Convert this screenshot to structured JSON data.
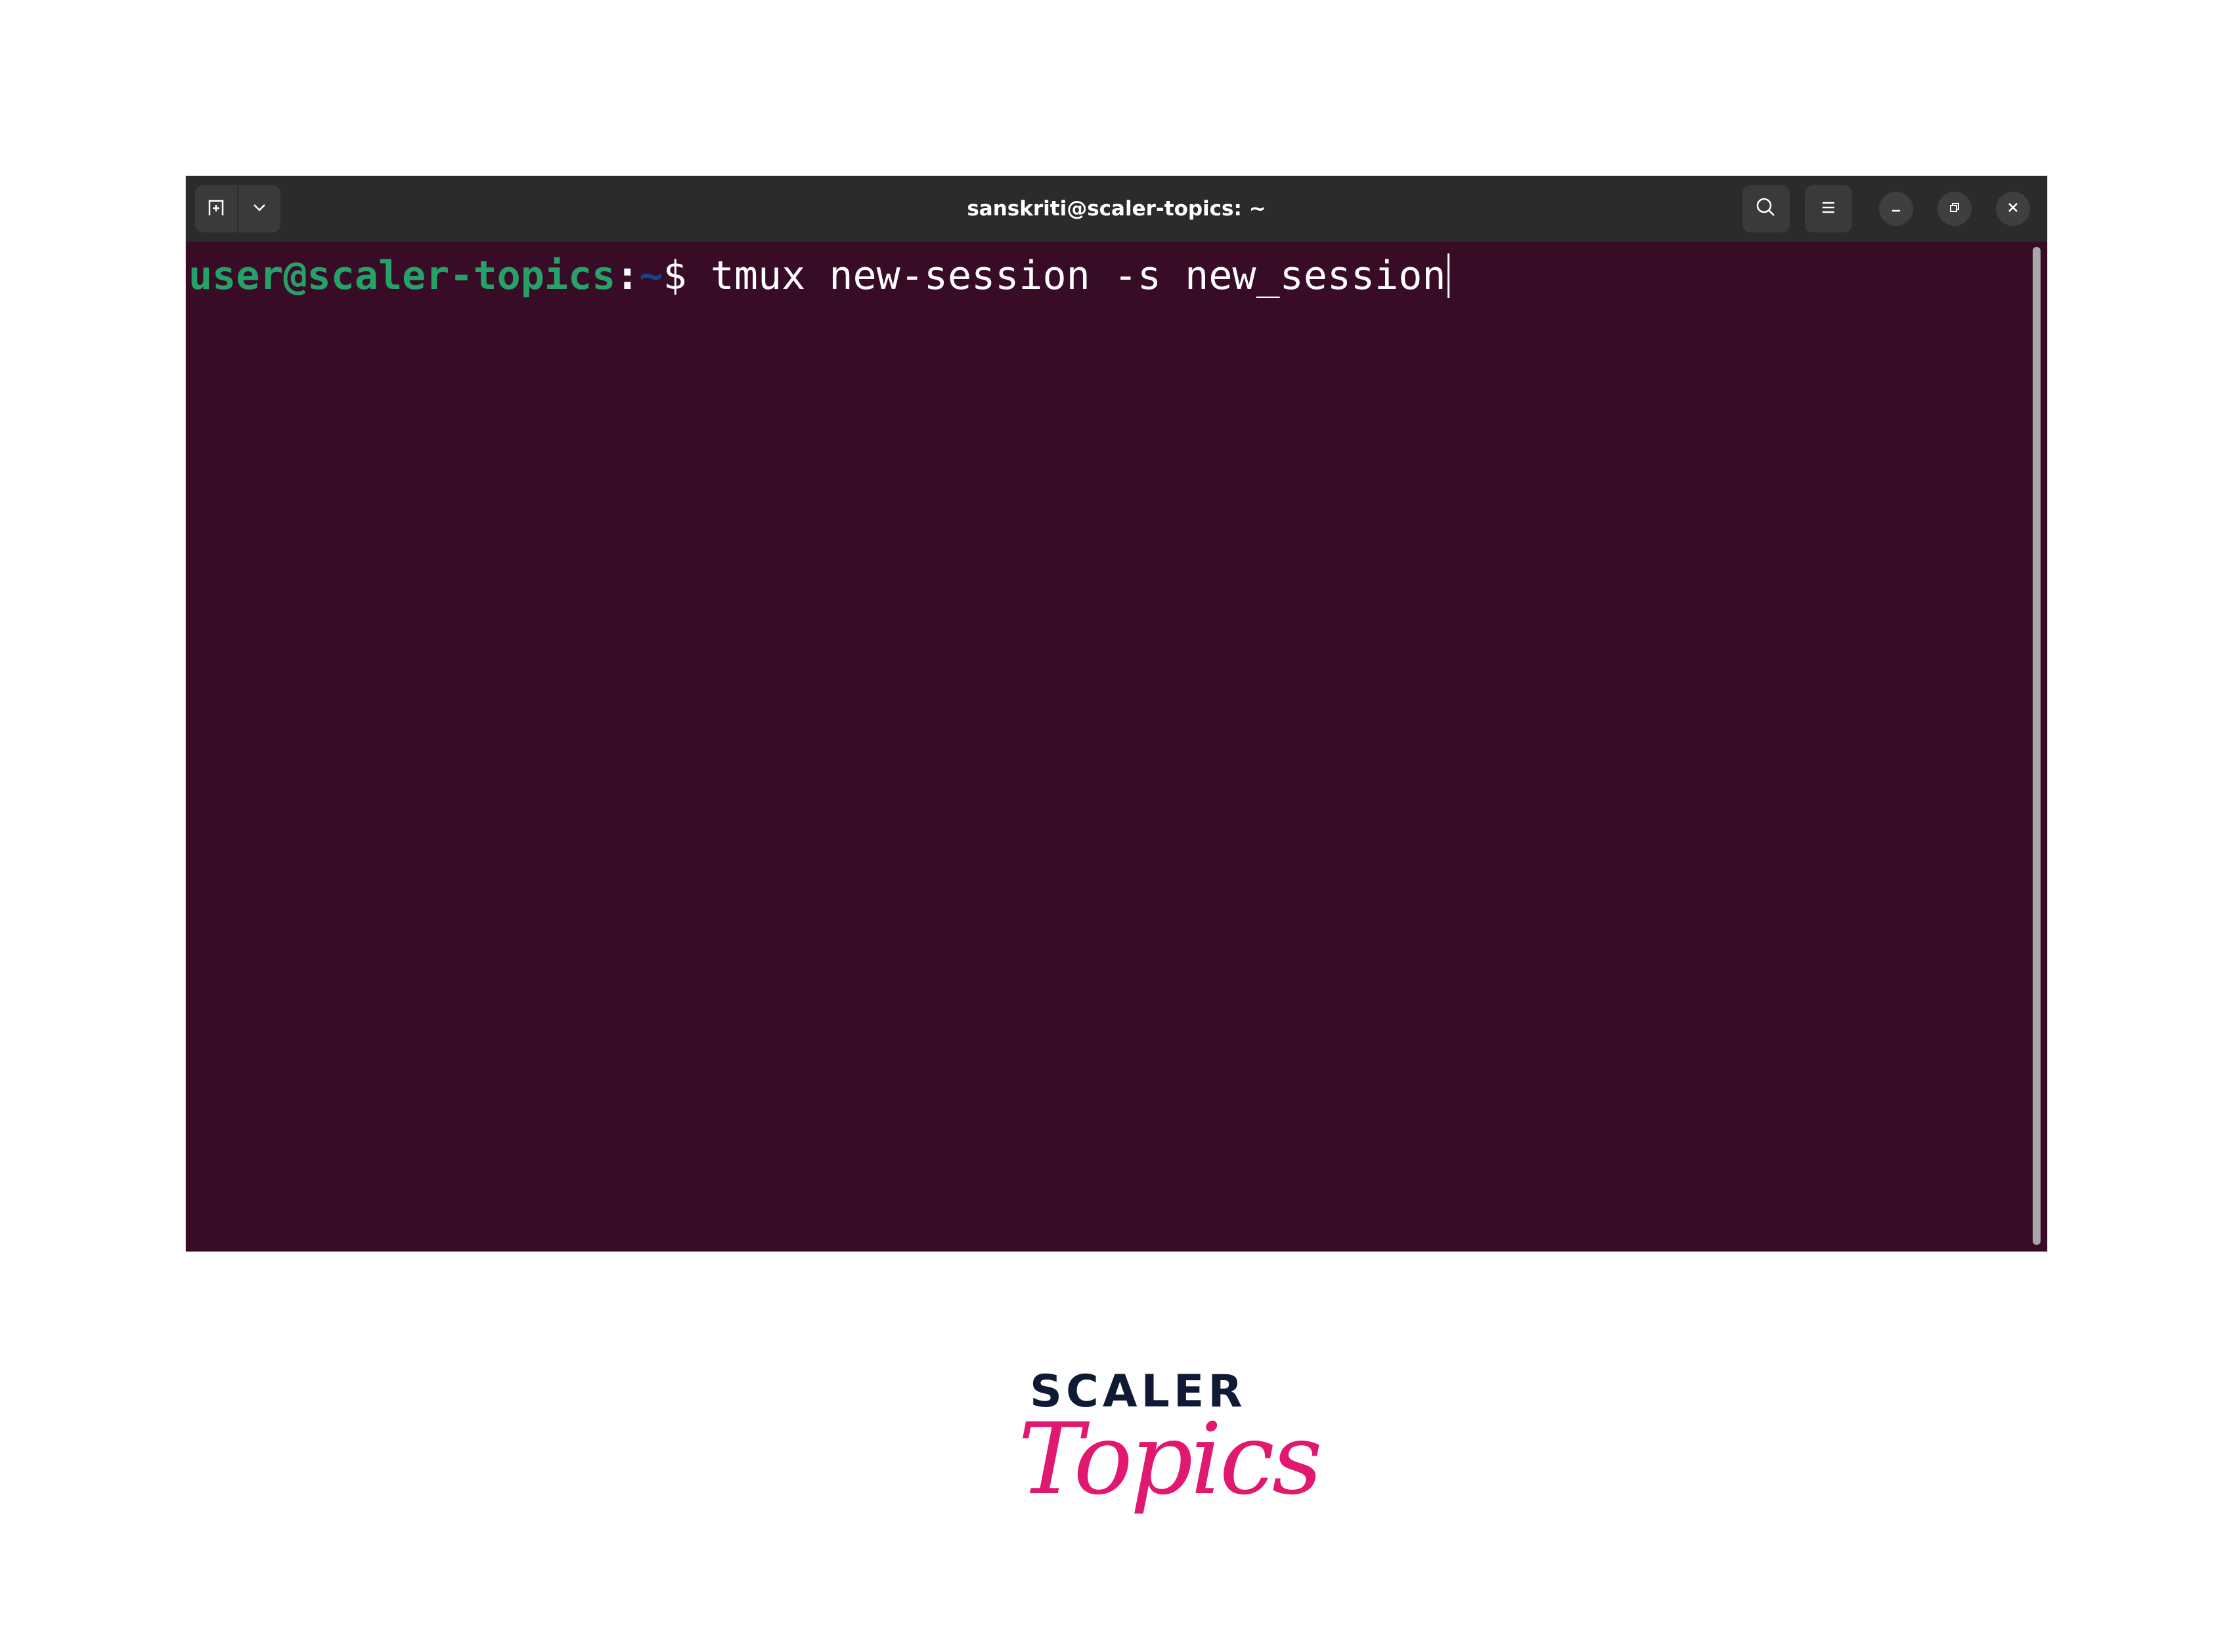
{
  "window": {
    "title": "sanskriti@scaler-topics: ~"
  },
  "toolbar": {
    "new_tab_icon": "new-tab-icon",
    "tab_dropdown_icon": "chevron-down-icon",
    "search_icon": "search-icon",
    "menu_icon": "hamburger-menu-icon",
    "minimize_icon": "minimize-icon",
    "maximize_icon": "restore-icon",
    "close_icon": "close-icon"
  },
  "terminal": {
    "prompt_user_host": "user@scaler-topics",
    "prompt_colon": ":",
    "prompt_path": "~",
    "prompt_symbol": "$",
    "command": " tmux new-session -s new_session"
  },
  "colors": {
    "terminal_bg": "#380c26",
    "titlebar_bg": "#2b2b2b",
    "prompt_user": "#26a269",
    "prompt_path": "#12488b",
    "logo_dark": "#0f1a35",
    "logo_pink": "#e0186f"
  },
  "logo": {
    "line1": "SCALER",
    "line2": "Topics"
  }
}
